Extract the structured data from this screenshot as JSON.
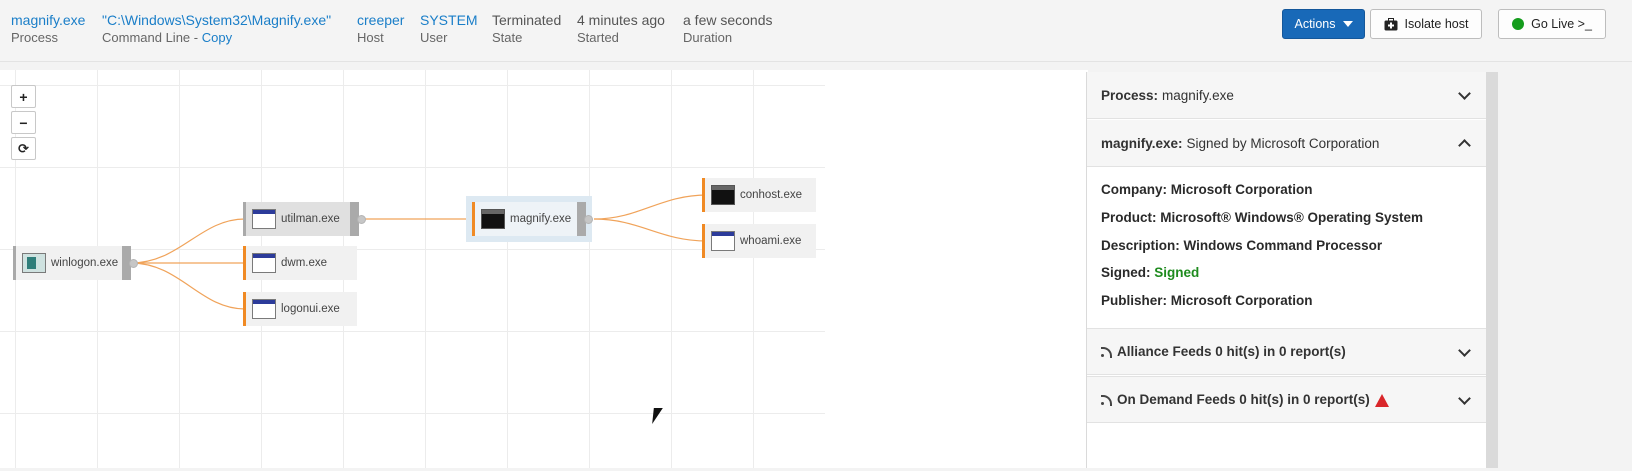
{
  "header": {
    "process": {
      "value": "magnify.exe",
      "label": "Process"
    },
    "command_line": {
      "value": "\"C:\\Windows\\System32\\Magnify.exe\"",
      "label": "Command Line - ",
      "copy_label": "Copy"
    },
    "host": {
      "value": "creeper",
      "label": "Host"
    },
    "user": {
      "value": "SYSTEM",
      "label": "User"
    },
    "state": {
      "value": "Terminated",
      "label": "State"
    },
    "started": {
      "value": "4 minutes ago",
      "label": "Started"
    },
    "duration": {
      "value": "a few seconds",
      "label": "Duration"
    },
    "actions_label": "Actions",
    "isolate_label": "Isolate host",
    "golive_label": "Go Live >_"
  },
  "graph": {
    "zoom_in": "+",
    "zoom_out": "−",
    "reset": "⟳",
    "nodes": {
      "winlogon": "winlogon.exe",
      "utilman": "utilman.exe",
      "dwm": "dwm.exe",
      "logonui": "logonui.exe",
      "magnify": "magnify.exe",
      "conhost": "conhost.exe",
      "whoami": "whoami.exe"
    },
    "edge_color": "#f0a35a"
  },
  "panel": {
    "process_section": {
      "key": "Process:",
      "value": "magnify.exe"
    },
    "signature_section": {
      "key": "magnify.exe:",
      "value": "Signed by Microsoft Corporation"
    },
    "details": {
      "company": "Company: Microsoft Corporation",
      "product": "Product: Microsoft® Windows® Operating System",
      "description": "Description: Windows Command Processor",
      "signed_key": "Signed: ",
      "signed_value": "Signed",
      "publisher": "Publisher: Microsoft Corporation"
    },
    "alliance": "Alliance Feeds 0 hit(s) in 0 report(s)",
    "ondemand": "On Demand Feeds 0 hit(s) in 0 report(s)"
  },
  "colors": {
    "accent": "#1a7ec8",
    "primary_button": "#1869b8",
    "node_bar": "#f08a24",
    "signed_green": "#1e8b1e",
    "warning": "#d9262a"
  }
}
